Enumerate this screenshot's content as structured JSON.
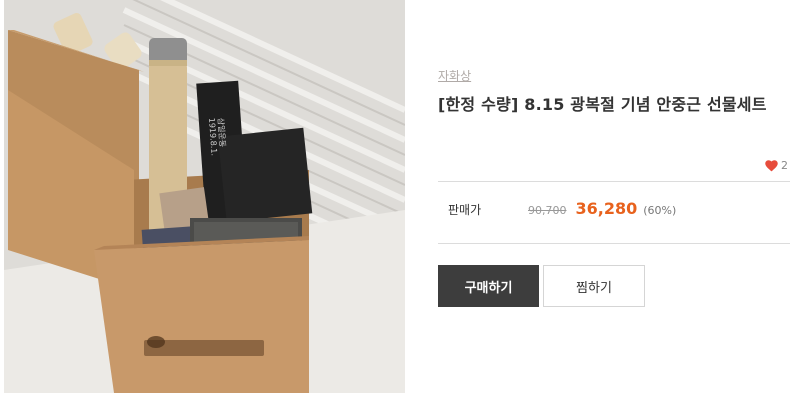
{
  "product": {
    "brand": "자화상",
    "title": "[한정 수량] 8.15 광복절 기념 안중근 선물세트",
    "like_count": "2",
    "price_label": "판매가",
    "original_price": "90,700",
    "sale_price": "36,280",
    "discount_rate": "(60%)"
  },
  "actions": {
    "buy_label": "구매하기",
    "wish_label": "찜하기"
  },
  "colors": {
    "accent": "#e8621d",
    "heart": "#e74c3c",
    "buy_button": "#3d3d3d"
  },
  "icons": {
    "like": "heart-icon"
  },
  "photo_text": {
    "card1_line1": "1919.8.1.",
    "card1_line2": "삼일운동"
  }
}
